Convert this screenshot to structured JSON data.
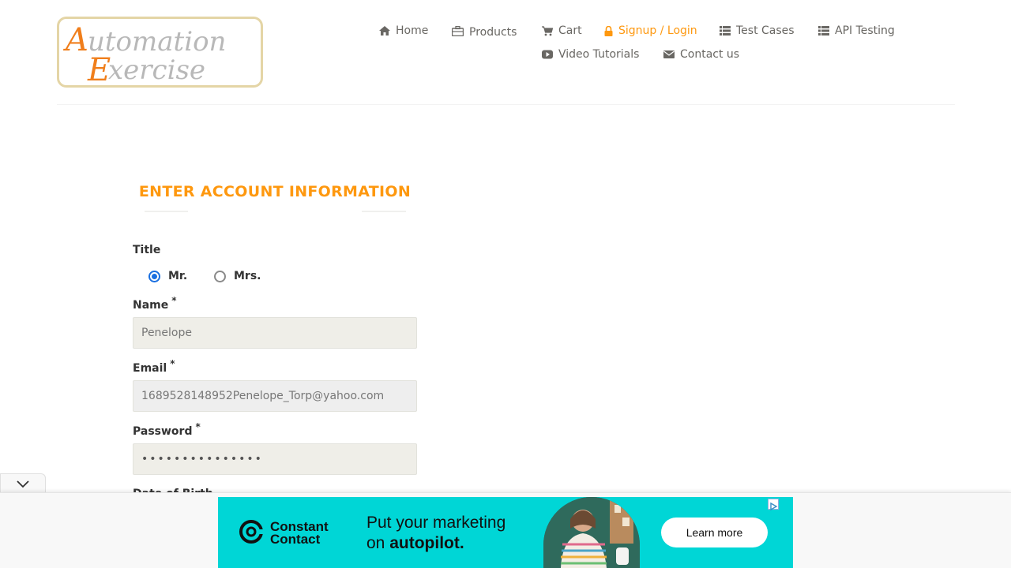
{
  "logo": {
    "line1": "Automation",
    "line2": "Exercise"
  },
  "nav": {
    "home": "Home",
    "products": "Products",
    "cart": "Cart",
    "signup_login": "Signup / Login",
    "test_cases": "Test Cases",
    "api_testing": "API Testing",
    "video_tutorials": "Video Tutorials",
    "contact_us": "Contact us",
    "active_color": "#fe980f"
  },
  "form": {
    "heading": "ENTER ACCOUNT INFORMATION",
    "title_label": "Title",
    "title_options": [
      {
        "label": "Mr.",
        "checked": true
      },
      {
        "label": "Mrs.",
        "checked": false
      }
    ],
    "name_label": "Name",
    "name_value": "Penelope",
    "email_label": "Email",
    "email_value": "1689528148952Penelope_Torp@yahoo.com",
    "password_label": "Password",
    "password_value": "•••••••••••••••",
    "dob_label": "Date of Birth",
    "required_mark": "*"
  },
  "ad": {
    "brand_line1": "Constant",
    "brand_line2": "Contact",
    "headline_line1": "Put your marketing",
    "headline_prefix": "on ",
    "headline_emphasis": "autopilot.",
    "cta": "Learn more"
  },
  "colors": {
    "accent": "#fe980f",
    "ad_bg": "#00d6d6"
  },
  "icons": [
    "home-icon",
    "briefcase-icon",
    "cart-icon",
    "lock-icon",
    "list-icon",
    "youtube-icon",
    "envelope-icon",
    "chevron-down-icon",
    "adchoices-icon"
  ]
}
